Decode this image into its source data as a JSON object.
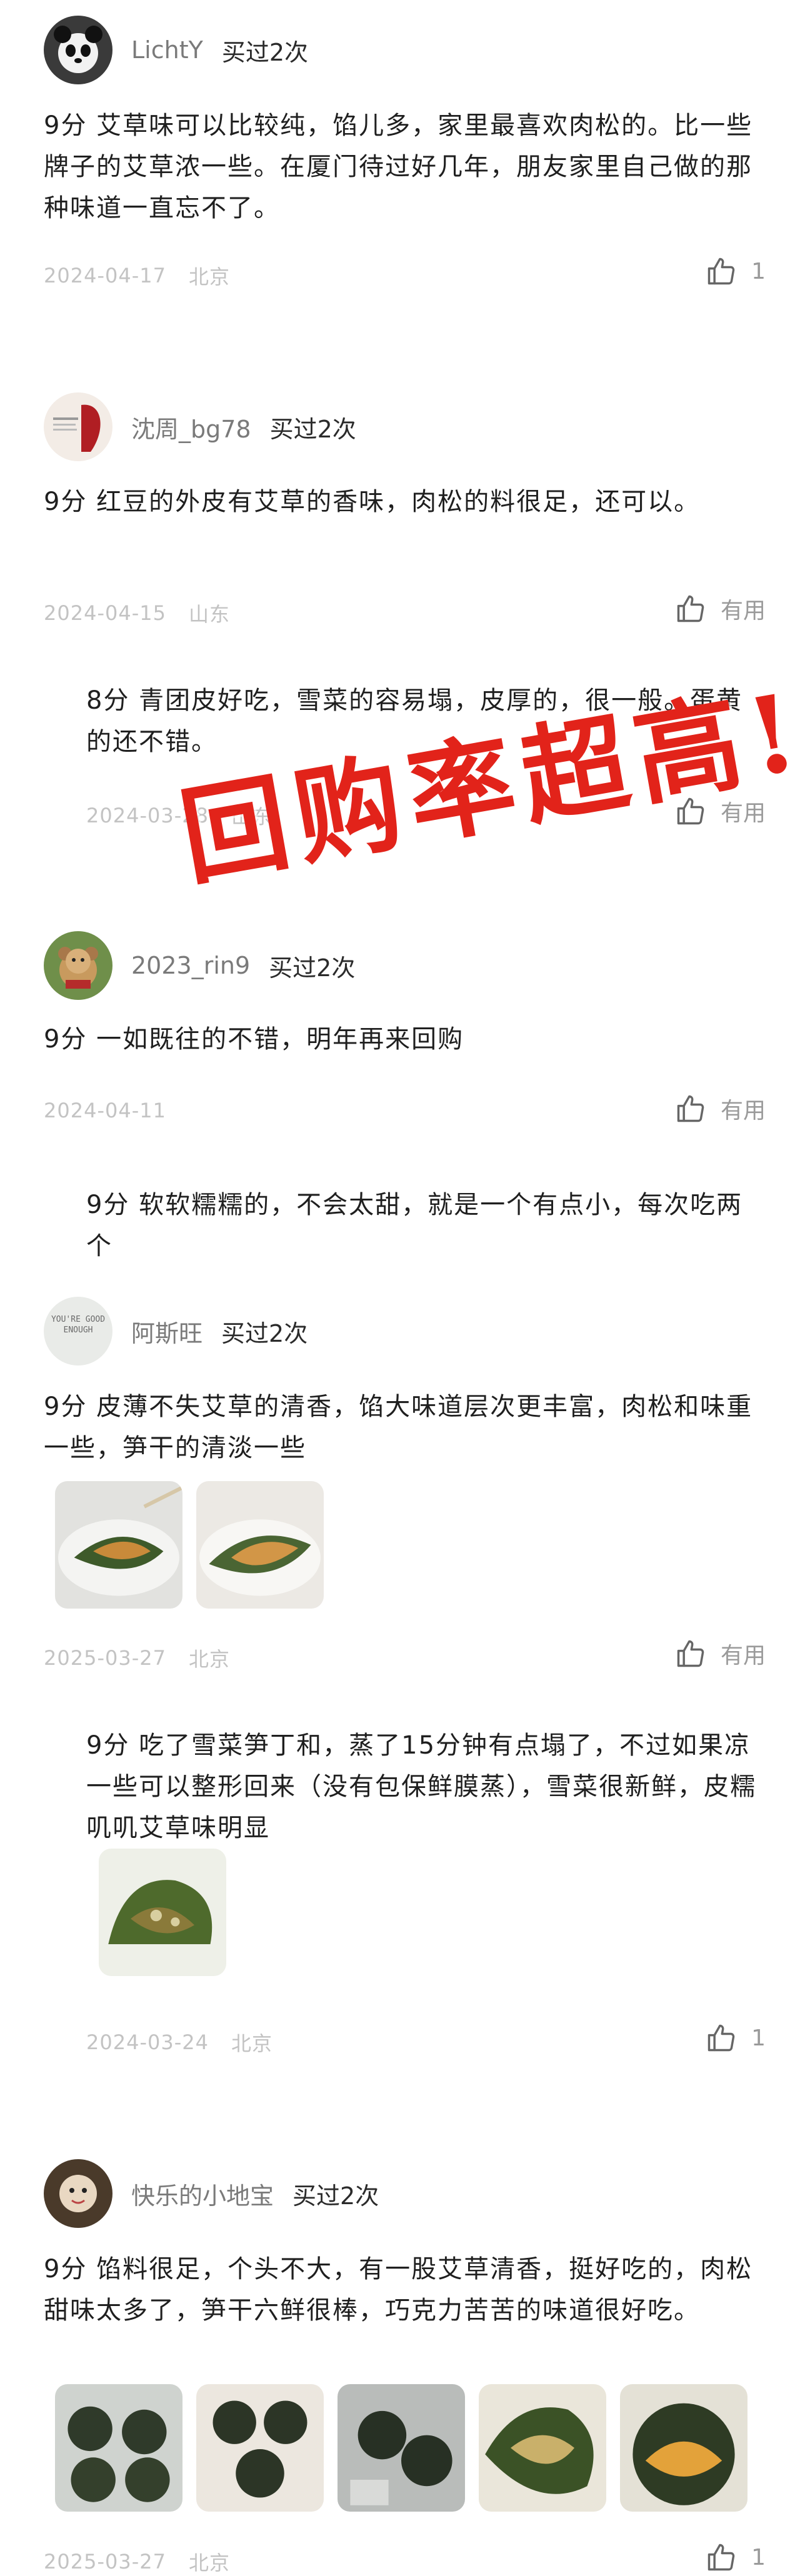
{
  "reviews": [
    {
      "username": "LichtY",
      "badge": "买过2次",
      "text": "9分  艾草味可以比较纯，馅儿多，家里最喜欢肉松的。比一些牌子的艾草浓一些。在厦门待过好几年，朋友家里自己做的那种味道一直忘不了。",
      "date": "2024-04-17",
      "location": "北京",
      "like_label": "1"
    },
    {
      "username": "沈周_bg78",
      "badge": "买过2次",
      "text": "9分  红豆的外皮有艾草的香味，肉松的料很足，还可以。",
      "date": "2024-04-15",
      "location": "山东",
      "like_label": "有用"
    },
    {
      "text": "8分  青团皮好吃，雪菜的容易塌，皮厚的，很一般。蛋黄的还不错。",
      "date": "2024-03-28",
      "location": "山东",
      "like_label": "有用"
    },
    {
      "username": "2023_rin9",
      "badge": "买过2次",
      "text": "9分  一如既往的不错，明年再来回购",
      "date": "2024-04-11",
      "like_label": "有用"
    },
    {
      "text": "9分  软软糯糯的，不会太甜，就是一个有点小，每次吃两个"
    },
    {
      "username": "阿斯旺",
      "badge": "买过2次",
      "text": "9分  皮薄不失艾草的清香，馅大味道层次更丰富，肉松和味重一些，笋干的清淡一些",
      "date": "2025-03-27",
      "location": "北京",
      "like_label": "有用"
    },
    {
      "text": "9分  吃了雪菜笋丁和，蒸了15分钟有点塌了，不过如果凉一些可以整形回来（没有包保鲜膜蒸），雪菜很新鲜，皮糯叽叽艾草味明显",
      "date": "2024-03-24",
      "location": "北京",
      "like_label": "1"
    },
    {
      "username": "快乐的小地宝",
      "badge": "买过2次",
      "text": "9分  馅料很足，个头不大，有一股艾草清香，挺好吃的，肉松甜味太多了，笋干六鲜很棒，巧克力苦苦的味道很好吃。",
      "date": "2025-03-27",
      "location": "北京",
      "like_label": "1"
    }
  ],
  "overlay": {
    "stamp_text": "回购率超高!",
    "color": "#e2231a"
  },
  "avatar_badge_text": "YOU'RE GOOD ENOUGH",
  "icons": {
    "like": "thumbs-up-icon"
  },
  "colors": {
    "meta": "#c3c3c3",
    "username": "#7a7a7a"
  }
}
